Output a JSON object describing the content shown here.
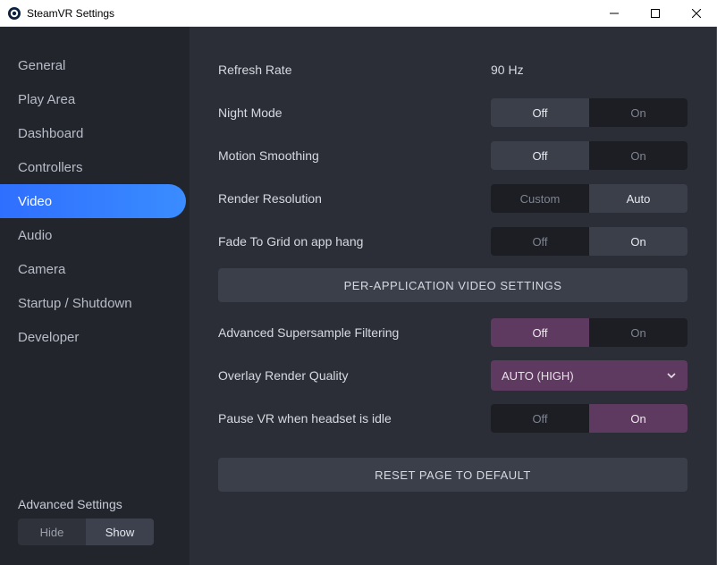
{
  "window": {
    "title": "SteamVR Settings"
  },
  "sidebar": {
    "items": [
      {
        "label": "General"
      },
      {
        "label": "Play Area"
      },
      {
        "label": "Dashboard"
      },
      {
        "label": "Controllers"
      },
      {
        "label": "Video"
      },
      {
        "label": "Audio"
      },
      {
        "label": "Camera"
      },
      {
        "label": "Startup / Shutdown"
      },
      {
        "label": "Developer"
      }
    ],
    "active_index": 4,
    "advanced": {
      "title": "Advanced Settings",
      "hide": "Hide",
      "show": "Show",
      "value": "Show"
    }
  },
  "labels": {
    "refresh_rate": "Refresh Rate",
    "night_mode": "Night Mode",
    "motion_smoothing": "Motion Smoothing",
    "render_resolution": "Render Resolution",
    "fade_to_grid": "Fade To Grid on app hang",
    "per_app": "PER-APPLICATION VIDEO SETTINGS",
    "adv_ss_filter": "Advanced Supersample Filtering",
    "overlay_quality": "Overlay Render Quality",
    "pause_idle": "Pause VR when headset is idle",
    "reset": "RESET PAGE TO DEFAULT"
  },
  "values": {
    "refresh_rate": "90 Hz",
    "night_mode": "Off",
    "motion_smoothing": "Off",
    "render_resolution": "Auto",
    "fade_to_grid": "On",
    "adv_ss_filter": "Off",
    "overlay_quality": "AUTO (HIGH)",
    "pause_idle": "On"
  },
  "options": {
    "off": "Off",
    "on": "On",
    "custom": "Custom",
    "auto": "Auto"
  }
}
